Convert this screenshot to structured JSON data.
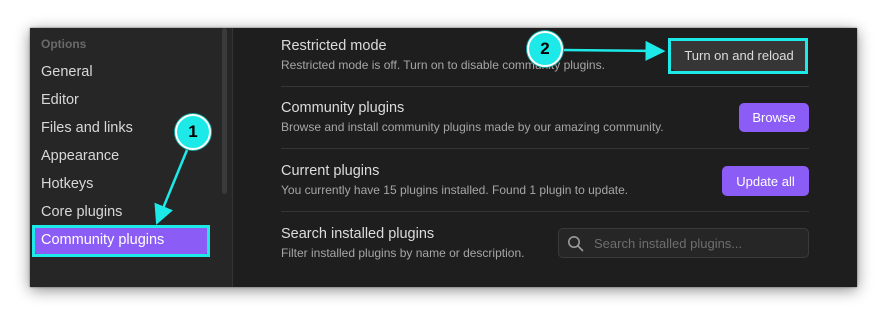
{
  "sidebar": {
    "heading": "Options",
    "items": [
      {
        "label": "General"
      },
      {
        "label": "Editor"
      },
      {
        "label": "Files and links"
      },
      {
        "label": "Appearance"
      },
      {
        "label": "Hotkeys"
      },
      {
        "label": "Core plugins"
      },
      {
        "label": "Community plugins",
        "active": true
      }
    ]
  },
  "settings": {
    "restricted": {
      "name": "Restricted mode",
      "desc": "Restricted mode is off. Turn on to disable community plugins.",
      "button": "Turn on and reload"
    },
    "community": {
      "name": "Community plugins",
      "desc": "Browse and install community plugins made by our amazing community.",
      "button": "Browse"
    },
    "current": {
      "name": "Current plugins",
      "desc": "You currently have 15 plugins installed. Found 1 plugin to update.",
      "button": "Update all"
    },
    "search": {
      "name": "Search installed plugins",
      "desc": "Filter installed plugins by name or description.",
      "placeholder": "Search installed plugins...",
      "icon": "search-icon"
    }
  },
  "annotations": {
    "step1": "1",
    "step2": "2"
  },
  "colors": {
    "accent": "#8b5cf6",
    "annotation": "#1de9e9",
    "background": "#1e1e1e",
    "sidebar": "#262626"
  }
}
